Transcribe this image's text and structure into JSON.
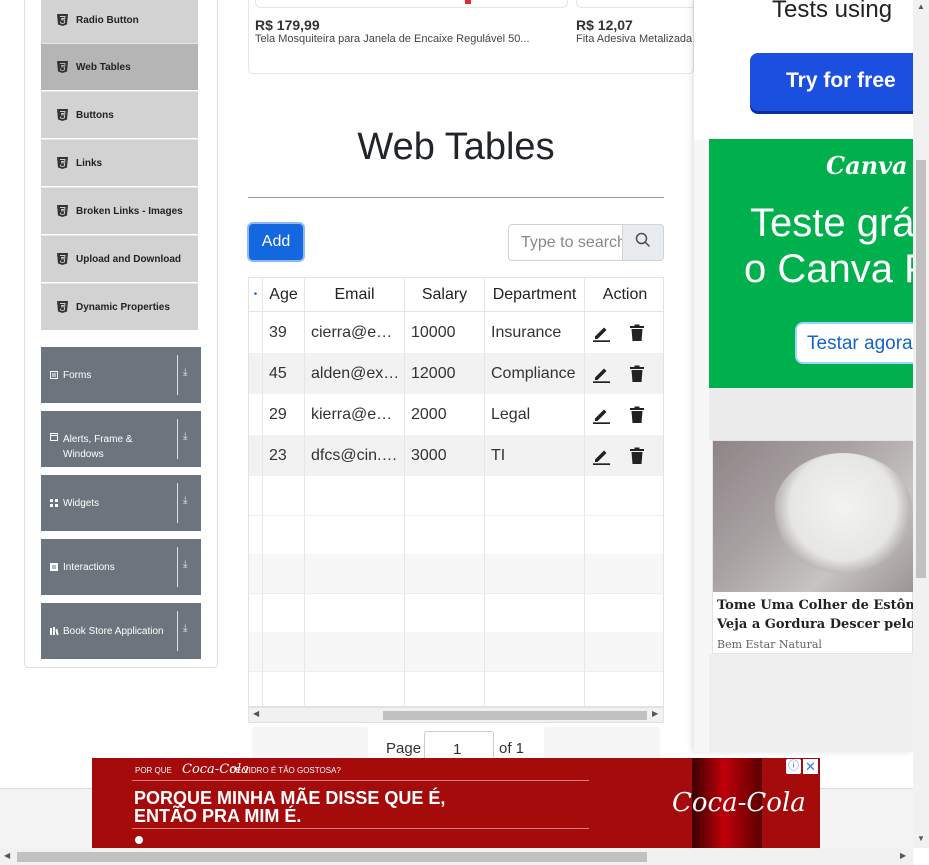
{
  "sidebar": {
    "items": [
      {
        "label": "Radio Button"
      },
      {
        "label": "Web Tables"
      },
      {
        "label": "Buttons"
      },
      {
        "label": "Links"
      },
      {
        "label": "Broken Links - Images"
      },
      {
        "label": "Upload and Download"
      },
      {
        "label": "Dynamic Properties"
      }
    ],
    "groups": [
      {
        "label": "Forms"
      },
      {
        "label_line1": "Alerts, Frame &",
        "label_line2": "Windows"
      },
      {
        "label": "Widgets"
      },
      {
        "label": "Interactions"
      },
      {
        "label": "Book Store Application"
      }
    ]
  },
  "products": [
    {
      "price": "R$ 179,99",
      "desc": "Tela Mosquiteira para Janela de Encaixe Regulável 50..."
    },
    {
      "price": "R$ 12,07",
      "desc": "Fita Adesiva Metalizada"
    }
  ],
  "page_title": "Web Tables",
  "toolbar": {
    "add_label": "Add",
    "search_placeholder": "Type to search"
  },
  "table": {
    "columns": [
      "Age",
      "Email",
      "Salary",
      "Department",
      "Action"
    ],
    "rows": [
      {
        "age": "39",
        "email": "cierra@example.com",
        "salary": "10000",
        "department": "Insurance"
      },
      {
        "age": "45",
        "email": "alden@example.com",
        "salary": "12000",
        "department": "Compliance"
      },
      {
        "age": "29",
        "email": "kierra@example.com",
        "salary": "2000",
        "department": "Legal"
      },
      {
        "age": "23",
        "email": "dfcs@cin.ufpe.br",
        "salary": "3000",
        "department": "TI"
      }
    ]
  },
  "pagination": {
    "page_label": "Page",
    "page_value": "1",
    "of_label": "of 1"
  },
  "ads": {
    "right_top_text": "Tests using",
    "right_top_button": "Try for free",
    "canva_logo": "Canva",
    "canva_line1": "Teste grá",
    "canva_line2": "o Canva P",
    "canva_button": "Testar agora",
    "article_title_line1": "Tome Uma Colher de Estômag",
    "article_title_line2": "Veja a Gordura Descer pelo Ra",
    "article_source": "Bem Estar Natural",
    "coke_top_a": "POR QUE",
    "coke_brand": "Coca-Cola",
    "coke_top_b": "DE VIDRO É TÃO GOSTOSA?",
    "coke_line1": "PORQUE MINHA MÃE DISSE QUE É,",
    "coke_line2": "ENTÃO PRA MIM É."
  },
  "colors": {
    "primary": "#1468df",
    "sidebar_group": "#6c757d",
    "canva_green": "#00b04c",
    "coke_red": "#a50b0b"
  }
}
